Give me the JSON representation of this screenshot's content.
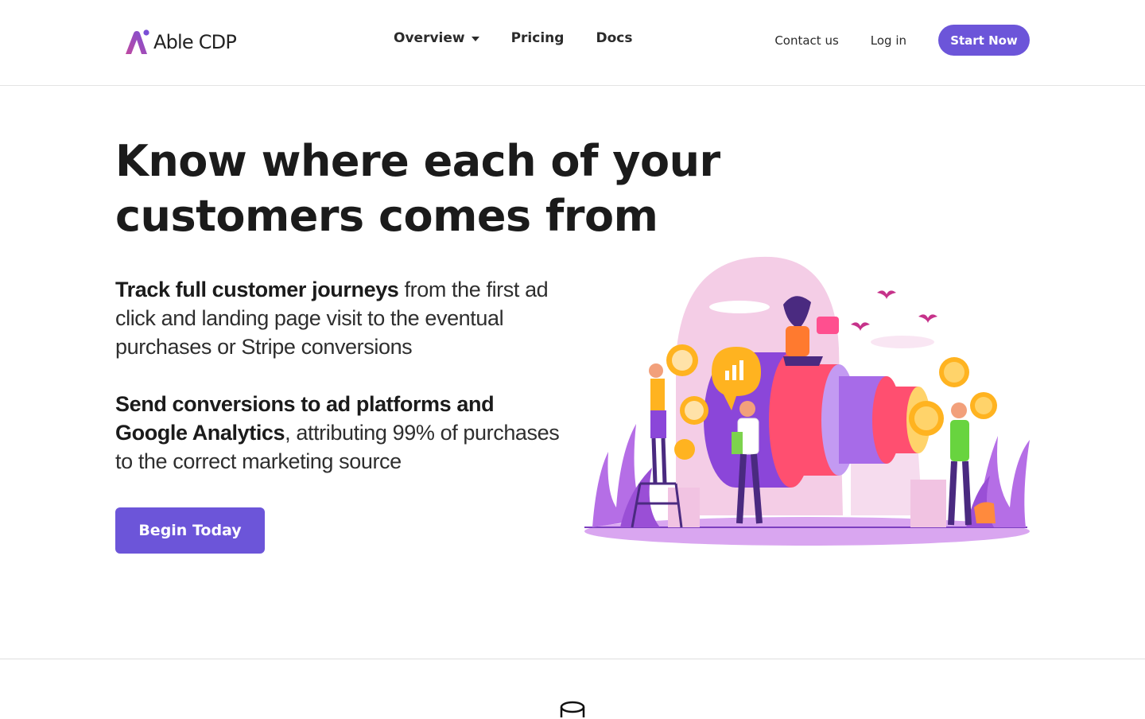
{
  "brand": {
    "name": "Able CDP",
    "accent": "#6c55d9",
    "logo_gradient": [
      "#c04aa0",
      "#7a4fd6"
    ]
  },
  "nav": {
    "overview": "Overview",
    "pricing": "Pricing",
    "docs": "Docs",
    "contact": "Contact us",
    "login": "Log in",
    "start": "Start Now"
  },
  "hero": {
    "title": "Know where each of your customers comes from",
    "p1_strong": "Track full customer journeys",
    "p1_rest": " from the first ad click and landing page visit to the eventual purchases or Stripe conversions",
    "p2_strong": "Send conversions to ad platforms and Google Analytics",
    "p2_rest": ", attributing 99% of purchases to the correct marketing source",
    "cta": "Begin Today"
  },
  "icons": {
    "dropdown": "caret-down-icon",
    "bottom": "database-icon"
  }
}
